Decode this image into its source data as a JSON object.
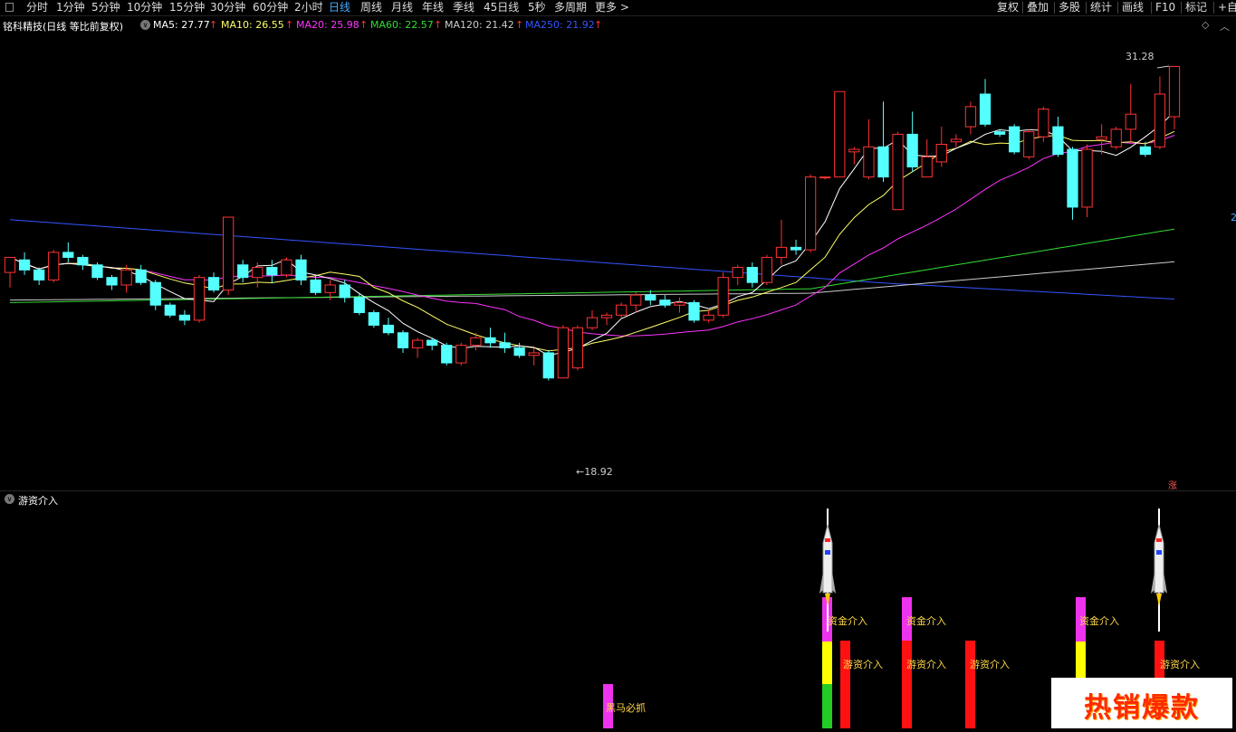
{
  "toolbar": {
    "periods": [
      "分时",
      "1分钟",
      "5分钟",
      "10分钟",
      "15分钟",
      "30分钟",
      "60分钟",
      "2小时",
      "日线",
      "周线",
      "月线",
      "年线",
      "季线",
      "45日线",
      "5秒",
      "多周期",
      "更多 >"
    ],
    "active_period": "日线",
    "right_items": [
      "复权",
      "叠加",
      "多股",
      "统计",
      "画线",
      "F10",
      "标记",
      "+自选"
    ]
  },
  "info": {
    "stock_title": "铭科精技(日线 等比前复权)",
    "ma5": "MA5: 27.77",
    "ma10": "MA10: 26.55",
    "ma20": "MA20: 25.98",
    "ma60": "MA60: 22.57",
    "ma120": "MA120: 21.42",
    "ma250": "MA250: 21.92",
    "up_arrow": "↑",
    "colors": {
      "ma5": "#ffffff",
      "ma10": "#ffff66",
      "ma20": "#ff33ff",
      "ma60": "#33dd33",
      "ma120": "#cccccc",
      "ma250": "#3355ff"
    }
  },
  "price_chart": {
    "high_label": "31.28",
    "low_label": "←18.92",
    "zhang_label": "涨",
    "right_edge_label": "2",
    "colors": {
      "up": "#ff3333",
      "down": "#54ffff"
    }
  },
  "indicator": {
    "title": "游资介入",
    "labels": {
      "heima": "黑马必抓",
      "zijin": "资金介入",
      "youzi": "游资介入"
    }
  },
  "ad": {
    "text": "热销爆款"
  },
  "chart_data": {
    "type": "candlestick",
    "title": "铭科精技(日线 等比前复权)",
    "xlabel": "",
    "ylabel": "",
    "ylim": [
      15.0,
      32.0
    ],
    "candles": [
      [
        23.1,
        23.7,
        22.5,
        23.6
      ],
      [
        23.6,
        23.2,
        23.0,
        23.9
      ],
      [
        23.2,
        22.8,
        22.6,
        23.3
      ],
      [
        22.8,
        23.9,
        22.7,
        24.0
      ],
      [
        23.9,
        23.7,
        23.5,
        24.3
      ],
      [
        23.7,
        23.4,
        23.2,
        23.8
      ],
      [
        23.4,
        22.9,
        22.8,
        23.5
      ],
      [
        22.9,
        22.6,
        22.4,
        23.0
      ],
      [
        22.6,
        23.2,
        22.3,
        23.4
      ],
      [
        23.2,
        22.7,
        22.6,
        23.4
      ],
      [
        22.7,
        21.8,
        21.6,
        22.8
      ],
      [
        21.8,
        21.4,
        21.3,
        21.9
      ],
      [
        21.4,
        21.2,
        21.0,
        21.6
      ],
      [
        21.2,
        22.9,
        21.1,
        23.0
      ],
      [
        22.9,
        22.4,
        22.3,
        23.1
      ],
      [
        22.4,
        25.3,
        22.2,
        25.3
      ],
      [
        23.4,
        22.9,
        22.7,
        23.6
      ],
      [
        22.9,
        23.3,
        22.5,
        23.5
      ],
      [
        23.3,
        23.0,
        22.7,
        23.6
      ],
      [
        23.0,
        23.6,
        22.9,
        23.7
      ],
      [
        23.6,
        22.8,
        22.6,
        23.8
      ],
      [
        22.8,
        22.3,
        22.2,
        23.0
      ],
      [
        22.3,
        22.6,
        22.0,
        22.8
      ],
      [
        22.6,
        22.1,
        21.9,
        22.8
      ],
      [
        22.1,
        21.5,
        21.4,
        22.3
      ],
      [
        21.5,
        21.0,
        20.9,
        21.6
      ],
      [
        21.0,
        20.7,
        20.6,
        21.3
      ],
      [
        20.7,
        20.1,
        19.9,
        20.8
      ],
      [
        20.1,
        20.4,
        19.7,
        20.5
      ],
      [
        20.4,
        20.2,
        20.0,
        20.5
      ],
      [
        20.2,
        19.5,
        19.4,
        20.3
      ],
      [
        19.5,
        20.2,
        19.4,
        20.3
      ],
      [
        20.2,
        20.5,
        20.0,
        20.7
      ],
      [
        20.5,
        20.3,
        20.1,
        20.9
      ],
      [
        20.3,
        20.1,
        19.9,
        20.7
      ],
      [
        20.1,
        19.8,
        19.7,
        20.3
      ],
      [
        19.8,
        19.9,
        19.4,
        20.1
      ],
      [
        19.9,
        18.9,
        18.8,
        20.0
      ],
      [
        18.9,
        20.9,
        18.9,
        21.0
      ],
      [
        19.3,
        20.9,
        19.2,
        21.0
      ],
      [
        20.9,
        21.3,
        20.8,
        21.6
      ],
      [
        21.3,
        21.4,
        21.0,
        21.5
      ],
      [
        21.4,
        21.8,
        21.3,
        21.9
      ],
      [
        21.8,
        22.2,
        21.5,
        22.3
      ],
      [
        22.2,
        22.0,
        21.8,
        22.4
      ],
      [
        22.0,
        21.8,
        21.7,
        22.2
      ],
      [
        21.8,
        21.9,
        21.5,
        22.1
      ],
      [
        21.9,
        21.2,
        21.1,
        22.0
      ],
      [
        21.2,
        21.4,
        21.1,
        21.6
      ],
      [
        21.4,
        22.9,
        21.3,
        23.1
      ],
      [
        22.9,
        23.3,
        22.6,
        23.4
      ],
      [
        23.3,
        22.7,
        22.5,
        23.5
      ],
      [
        22.7,
        23.7,
        22.6,
        23.8
      ],
      [
        23.7,
        24.1,
        23.4,
        25.2
      ],
      [
        24.1,
        24.0,
        23.8,
        24.4
      ],
      [
        24.0,
        26.9,
        23.9,
        27.0
      ],
      [
        26.9,
        26.9,
        26.8,
        26.9
      ],
      [
        26.9,
        30.3,
        26.9,
        30.3
      ],
      [
        27.9,
        28.0,
        27.4,
        28.1
      ],
      [
        26.9,
        28.1,
        26.8,
        29.2
      ],
      [
        28.1,
        26.9,
        26.7,
        29.9
      ],
      [
        25.6,
        28.6,
        25.6,
        28.7
      ],
      [
        28.6,
        27.3,
        27.1,
        29.5
      ],
      [
        26.9,
        27.7,
        26.9,
        28.4
      ],
      [
        27.5,
        28.2,
        27.3,
        28.9
      ],
      [
        28.3,
        28.4,
        28.1,
        28.6
      ],
      [
        28.9,
        29.7,
        28.6,
        29.9
      ],
      [
        30.2,
        29.0,
        28.9,
        30.8
      ],
      [
        28.7,
        28.6,
        28.5,
        28.8
      ],
      [
        28.9,
        27.9,
        27.8,
        29.0
      ],
      [
        27.7,
        28.7,
        27.6,
        28.8
      ],
      [
        28.5,
        29.6,
        28.3,
        29.7
      ],
      [
        28.9,
        27.8,
        27.7,
        29.3
      ],
      [
        28.0,
        25.7,
        25.2,
        28.1
      ],
      [
        25.7,
        28.0,
        25.3,
        28.2
      ],
      [
        28.4,
        28.5,
        27.8,
        29.0
      ],
      [
        28.1,
        28.8,
        28.0,
        28.9
      ],
      [
        28.8,
        29.4,
        28.3,
        30.6
      ],
      [
        28.1,
        27.8,
        27.7,
        28.3
      ],
      [
        28.1,
        30.2,
        28.0,
        30.9
      ],
      [
        29.3,
        31.3,
        28.8,
        31.3
      ]
    ],
    "ma": {
      "MA5": 27.77,
      "MA10": 26.55,
      "MA20": 25.98,
      "MA60": 22.57,
      "MA120": 21.42,
      "MA250": 21.92
    },
    "high_value": 31.28,
    "low_value": 18.92
  }
}
